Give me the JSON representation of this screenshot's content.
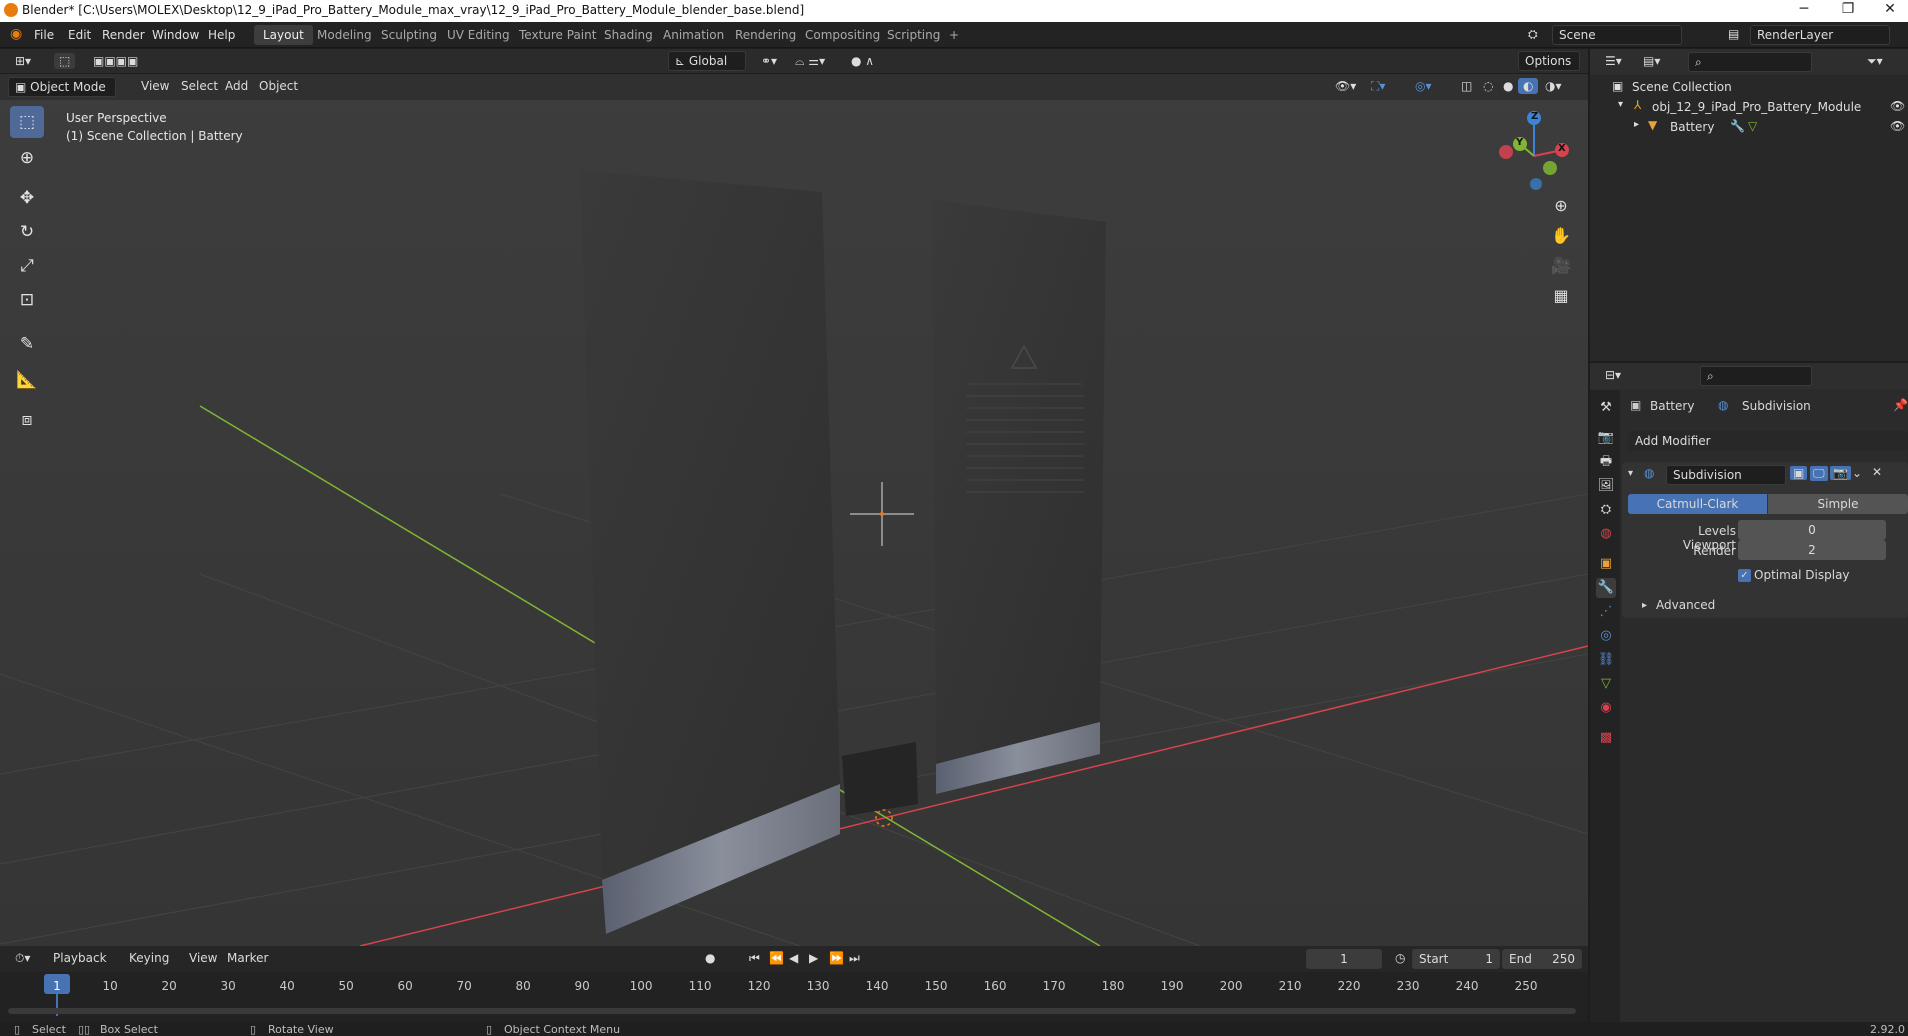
{
  "window": {
    "title": "Blender* [C:\\Users\\MOLEX\\Desktop\\12_9_iPad_Pro_Battery_Module_max_vray\\12_9_iPad_Pro_Battery_Module_blender_base.blend]",
    "minimize": "─",
    "maximize": "❐",
    "close": "✕"
  },
  "menus": [
    "File",
    "Edit",
    "Render",
    "Window",
    "Help"
  ],
  "workspaces": [
    "Layout",
    "Modeling",
    "Sculpting",
    "UV Editing",
    "Texture Paint",
    "Shading",
    "Animation",
    "Rendering",
    "Compositing",
    "Scripting",
    "+"
  ],
  "scene": {
    "scene_name": "Scene",
    "render_layer": "RenderLayer"
  },
  "tool_header": {
    "orientation": "Global",
    "options": "Options"
  },
  "viewport_header": {
    "mode": "Object Mode",
    "menus": [
      "View",
      "Select",
      "Add",
      "Object"
    ]
  },
  "viewport": {
    "perspective": "User Perspective",
    "collection_info": "(1) Scene Collection | Battery",
    "gizmo": {
      "x": "X",
      "y": "Y",
      "z": "Z"
    }
  },
  "outliner": {
    "root": "Scene Collection",
    "items": [
      {
        "label": "obj_12_9_iPad_Pro_Battery_Module"
      },
      {
        "label": "Battery"
      }
    ]
  },
  "properties": {
    "object": "Battery",
    "modifier_tab": "Subdivision",
    "add_modifier": "Add Modifier",
    "modifier": {
      "name": "Subdivision",
      "modes": [
        "Catmull-Clark",
        "Simple"
      ],
      "active_mode": "Catmull-Clark",
      "levels_viewport_label": "Levels Viewport",
      "levels_viewport": "0",
      "render_label": "Render",
      "render": "2",
      "optimal_display": "Optimal Display",
      "optimal_display_checked": true,
      "advanced": "Advanced"
    }
  },
  "timeline": {
    "menus": [
      "Playback",
      "Keying",
      "View",
      "Marker"
    ],
    "current_frame": "1",
    "start_label": "Start",
    "start": "1",
    "end_label": "End",
    "end": "250",
    "ticks": [
      "1",
      "10",
      "20",
      "30",
      "40",
      "50",
      "60",
      "70",
      "80",
      "90",
      "100",
      "110",
      "120",
      "130",
      "140",
      "150",
      "160",
      "170",
      "180",
      "190",
      "200",
      "210",
      "220",
      "230",
      "240",
      "250"
    ]
  },
  "statusbar": {
    "select": "Select",
    "box_select": "Box Select",
    "rotate_view": "Rotate View",
    "context_menu": "Object Context Menu",
    "version": "2.92.0"
  },
  "colors": {
    "accent": "#4772b3",
    "x_axis": "#d8424f",
    "y_axis": "#80b632",
    "z_axis": "#3b84d8",
    "origin": "#e87d0d"
  }
}
